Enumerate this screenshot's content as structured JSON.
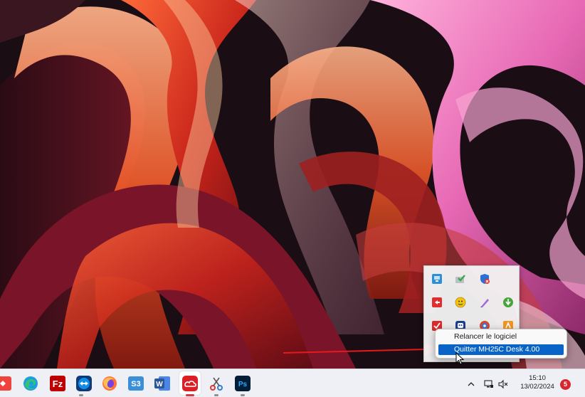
{
  "tray_overflow": {
    "icons": [
      {
        "name": "network-app-icon",
        "color": "#2e8fd8"
      },
      {
        "name": "green-check-icon",
        "color": "#3aa64a"
      },
      {
        "name": "shield-alert-icon",
        "color": "#2d6fd2"
      },
      {
        "name": "red-arrow-app-icon",
        "color": "#e02d2d"
      },
      {
        "name": "yellow-smiley-icon",
        "color": "#f2c311"
      },
      {
        "name": "purple-pen-icon",
        "color": "#9d6bd8"
      },
      {
        "name": "torrent-icon",
        "color": "#49a33b"
      },
      {
        "name": "red-check-app-icon",
        "color": "#d92b2b"
      },
      {
        "name": "blue-robot-icon",
        "color": "#1d3f8a"
      },
      {
        "name": "globe-app-icon",
        "color": "#d8452e"
      },
      {
        "name": "orange-app-icon",
        "color": "#f39322"
      }
    ]
  },
  "context_menu": {
    "items": [
      {
        "label": "Relancer le logiciel"
      },
      {
        "label": "Quitter MH25C Desk 4.00",
        "highlighted": true
      }
    ]
  },
  "taskbar": {
    "apps": [
      {
        "name": "anydesk-icon",
        "color": "#ef443b"
      },
      {
        "name": "edge-icon",
        "color": "#1b9de2"
      },
      {
        "name": "filezilla-icon",
        "color": "#bf0000"
      },
      {
        "name": "teamviewer-icon",
        "color": "#0e8ee9"
      },
      {
        "name": "firefox-icon",
        "color": "#ff7139"
      },
      {
        "name": "s3-app-icon",
        "color": "#3b8fd6"
      },
      {
        "name": "word-icon",
        "color": "#2b579a"
      },
      {
        "name": "creative-cloud-icon",
        "color": "#da1f26"
      },
      {
        "name": "snipping-tool-icon",
        "color": "#e5342e"
      },
      {
        "name": "photoshop-icon",
        "color": "#001e36"
      }
    ],
    "s3_label": "S3",
    "word_label": "W",
    "ps_label": "Ps",
    "fz_label": "Fz",
    "clock": {
      "time": "15:10",
      "date": "13/02/2024"
    },
    "notification_count": "5"
  }
}
